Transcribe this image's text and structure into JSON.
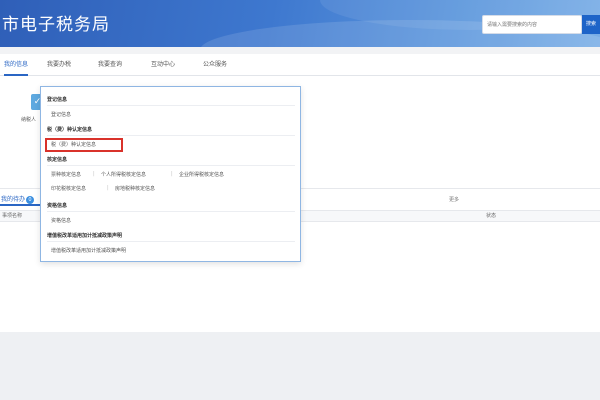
{
  "header": {
    "title": "市电子税务局",
    "search_placeholder": "请输入需要搜索的内容",
    "search_button": "搜索"
  },
  "nav": {
    "items": [
      "我的信息",
      "我要办税",
      "我要查询",
      "互动中心",
      "公众服务"
    ],
    "active_index": 0
  },
  "quick_access": {
    "label": "纳税人"
  },
  "dropdown": {
    "sections": [
      {
        "heading": "登记信息",
        "links": [
          "登记信息"
        ]
      },
      {
        "heading": "税（费）种认定信息",
        "links": [
          "税（费）种认定信息"
        ]
      },
      {
        "heading": "核定信息",
        "links": [
          "票种核定信息",
          "个人所得税核定信息",
          "企业所得税核定信息",
          "印花税核定信息",
          "房地税种核定信息"
        ]
      },
      {
        "heading": "资格信息",
        "links": [
          "资格信息"
        ]
      },
      {
        "heading": "增值税改革适用加计抵减政策声明",
        "links": [
          "增值税改革适用加计抵减政策声明"
        ]
      }
    ],
    "highlighted": "税（费）种认定信息",
    "highlight_color": "#d9322b"
  },
  "todo": {
    "tab_label": "我的待办",
    "badge": "0",
    "more_label": "更多",
    "columns": [
      "事项名称",
      "状态"
    ]
  },
  "colors": {
    "header_blue": "#2f5fb8",
    "accent": "#2a66c4"
  }
}
